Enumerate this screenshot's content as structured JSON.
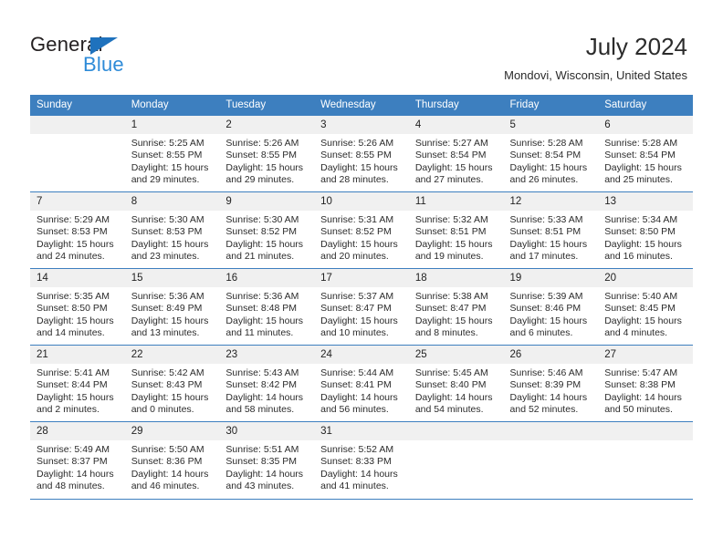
{
  "brand": {
    "name_top": "General",
    "name_bottom": "Blue"
  },
  "header": {
    "title": "July 2024",
    "subtitle": "Mondovi, Wisconsin, United States"
  },
  "colors": {
    "header_blue": "#3d7fbf",
    "brand_blue": "#2e8bd8",
    "daynum_bg": "#f0f0f0"
  },
  "weekday_headers": [
    "Sunday",
    "Monday",
    "Tuesday",
    "Wednesday",
    "Thursday",
    "Friday",
    "Saturday"
  ],
  "labels": {
    "sunrise_prefix": "Sunrise:",
    "sunset_prefix": "Sunset:",
    "daylight_prefix": "Daylight:"
  },
  "weeks": [
    [
      {
        "date": "",
        "line1": "",
        "line2": "",
        "line3": "",
        "line4": ""
      },
      {
        "date": "1",
        "line1": "Sunrise: 5:25 AM",
        "line2": "Sunset: 8:55 PM",
        "line3": "Daylight: 15 hours",
        "line4": "and 29 minutes."
      },
      {
        "date": "2",
        "line1": "Sunrise: 5:26 AM",
        "line2": "Sunset: 8:55 PM",
        "line3": "Daylight: 15 hours",
        "line4": "and 29 minutes."
      },
      {
        "date": "3",
        "line1": "Sunrise: 5:26 AM",
        "line2": "Sunset: 8:55 PM",
        "line3": "Daylight: 15 hours",
        "line4": "and 28 minutes."
      },
      {
        "date": "4",
        "line1": "Sunrise: 5:27 AM",
        "line2": "Sunset: 8:54 PM",
        "line3": "Daylight: 15 hours",
        "line4": "and 27 minutes."
      },
      {
        "date": "5",
        "line1": "Sunrise: 5:28 AM",
        "line2": "Sunset: 8:54 PM",
        "line3": "Daylight: 15 hours",
        "line4": "and 26 minutes."
      },
      {
        "date": "6",
        "line1": "Sunrise: 5:28 AM",
        "line2": "Sunset: 8:54 PM",
        "line3": "Daylight: 15 hours",
        "line4": "and 25 minutes."
      }
    ],
    [
      {
        "date": "7",
        "line1": "Sunrise: 5:29 AM",
        "line2": "Sunset: 8:53 PM",
        "line3": "Daylight: 15 hours",
        "line4": "and 24 minutes."
      },
      {
        "date": "8",
        "line1": "Sunrise: 5:30 AM",
        "line2": "Sunset: 8:53 PM",
        "line3": "Daylight: 15 hours",
        "line4": "and 23 minutes."
      },
      {
        "date": "9",
        "line1": "Sunrise: 5:30 AM",
        "line2": "Sunset: 8:52 PM",
        "line3": "Daylight: 15 hours",
        "line4": "and 21 minutes."
      },
      {
        "date": "10",
        "line1": "Sunrise: 5:31 AM",
        "line2": "Sunset: 8:52 PM",
        "line3": "Daylight: 15 hours",
        "line4": "and 20 minutes."
      },
      {
        "date": "11",
        "line1": "Sunrise: 5:32 AM",
        "line2": "Sunset: 8:51 PM",
        "line3": "Daylight: 15 hours",
        "line4": "and 19 minutes."
      },
      {
        "date": "12",
        "line1": "Sunrise: 5:33 AM",
        "line2": "Sunset: 8:51 PM",
        "line3": "Daylight: 15 hours",
        "line4": "and 17 minutes."
      },
      {
        "date": "13",
        "line1": "Sunrise: 5:34 AM",
        "line2": "Sunset: 8:50 PM",
        "line3": "Daylight: 15 hours",
        "line4": "and 16 minutes."
      }
    ],
    [
      {
        "date": "14",
        "line1": "Sunrise: 5:35 AM",
        "line2": "Sunset: 8:50 PM",
        "line3": "Daylight: 15 hours",
        "line4": "and 14 minutes."
      },
      {
        "date": "15",
        "line1": "Sunrise: 5:36 AM",
        "line2": "Sunset: 8:49 PM",
        "line3": "Daylight: 15 hours",
        "line4": "and 13 minutes."
      },
      {
        "date": "16",
        "line1": "Sunrise: 5:36 AM",
        "line2": "Sunset: 8:48 PM",
        "line3": "Daylight: 15 hours",
        "line4": "and 11 minutes."
      },
      {
        "date": "17",
        "line1": "Sunrise: 5:37 AM",
        "line2": "Sunset: 8:47 PM",
        "line3": "Daylight: 15 hours",
        "line4": "and 10 minutes."
      },
      {
        "date": "18",
        "line1": "Sunrise: 5:38 AM",
        "line2": "Sunset: 8:47 PM",
        "line3": "Daylight: 15 hours",
        "line4": "and 8 minutes."
      },
      {
        "date": "19",
        "line1": "Sunrise: 5:39 AM",
        "line2": "Sunset: 8:46 PM",
        "line3": "Daylight: 15 hours",
        "line4": "and 6 minutes."
      },
      {
        "date": "20",
        "line1": "Sunrise: 5:40 AM",
        "line2": "Sunset: 8:45 PM",
        "line3": "Daylight: 15 hours",
        "line4": "and 4 minutes."
      }
    ],
    [
      {
        "date": "21",
        "line1": "Sunrise: 5:41 AM",
        "line2": "Sunset: 8:44 PM",
        "line3": "Daylight: 15 hours",
        "line4": "and 2 minutes."
      },
      {
        "date": "22",
        "line1": "Sunrise: 5:42 AM",
        "line2": "Sunset: 8:43 PM",
        "line3": "Daylight: 15 hours",
        "line4": "and 0 minutes."
      },
      {
        "date": "23",
        "line1": "Sunrise: 5:43 AM",
        "line2": "Sunset: 8:42 PM",
        "line3": "Daylight: 14 hours",
        "line4": "and 58 minutes."
      },
      {
        "date": "24",
        "line1": "Sunrise: 5:44 AM",
        "line2": "Sunset: 8:41 PM",
        "line3": "Daylight: 14 hours",
        "line4": "and 56 minutes."
      },
      {
        "date": "25",
        "line1": "Sunrise: 5:45 AM",
        "line2": "Sunset: 8:40 PM",
        "line3": "Daylight: 14 hours",
        "line4": "and 54 minutes."
      },
      {
        "date": "26",
        "line1": "Sunrise: 5:46 AM",
        "line2": "Sunset: 8:39 PM",
        "line3": "Daylight: 14 hours",
        "line4": "and 52 minutes."
      },
      {
        "date": "27",
        "line1": "Sunrise: 5:47 AM",
        "line2": "Sunset: 8:38 PM",
        "line3": "Daylight: 14 hours",
        "line4": "and 50 minutes."
      }
    ],
    [
      {
        "date": "28",
        "line1": "Sunrise: 5:49 AM",
        "line2": "Sunset: 8:37 PM",
        "line3": "Daylight: 14 hours",
        "line4": "and 48 minutes."
      },
      {
        "date": "29",
        "line1": "Sunrise: 5:50 AM",
        "line2": "Sunset: 8:36 PM",
        "line3": "Daylight: 14 hours",
        "line4": "and 46 minutes."
      },
      {
        "date": "30",
        "line1": "Sunrise: 5:51 AM",
        "line2": "Sunset: 8:35 PM",
        "line3": "Daylight: 14 hours",
        "line4": "and 43 minutes."
      },
      {
        "date": "31",
        "line1": "Sunrise: 5:52 AM",
        "line2": "Sunset: 8:33 PM",
        "line3": "Daylight: 14 hours",
        "line4": "and 41 minutes."
      },
      {
        "date": "",
        "line1": "",
        "line2": "",
        "line3": "",
        "line4": ""
      },
      {
        "date": "",
        "line1": "",
        "line2": "",
        "line3": "",
        "line4": ""
      },
      {
        "date": "",
        "line1": "",
        "line2": "",
        "line3": "",
        "line4": ""
      }
    ]
  ]
}
